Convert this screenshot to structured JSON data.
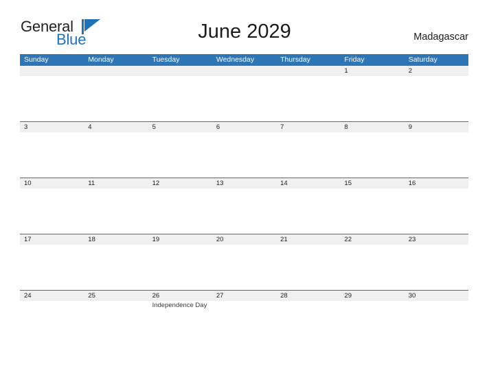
{
  "brand": {
    "name_part1": "General",
    "name_part2": "Blue",
    "mark": "triangle-logo-mark",
    "color_dark": "#231f20",
    "color_blue": "#2072b8"
  },
  "header": {
    "title": "June 2029",
    "country": "Madagascar"
  },
  "calendar": {
    "accent_color": "#2e75b6",
    "band_color": "#f0f0f0",
    "weekdays": [
      "Sunday",
      "Monday",
      "Tuesday",
      "Wednesday",
      "Thursday",
      "Friday",
      "Saturday"
    ],
    "weeks": [
      [
        {
          "date": "",
          "event": ""
        },
        {
          "date": "",
          "event": ""
        },
        {
          "date": "",
          "event": ""
        },
        {
          "date": "",
          "event": ""
        },
        {
          "date": "",
          "event": ""
        },
        {
          "date": "1",
          "event": ""
        },
        {
          "date": "2",
          "event": ""
        }
      ],
      [
        {
          "date": "3",
          "event": ""
        },
        {
          "date": "4",
          "event": ""
        },
        {
          "date": "5",
          "event": ""
        },
        {
          "date": "6",
          "event": ""
        },
        {
          "date": "7",
          "event": ""
        },
        {
          "date": "8",
          "event": ""
        },
        {
          "date": "9",
          "event": ""
        }
      ],
      [
        {
          "date": "10",
          "event": ""
        },
        {
          "date": "11",
          "event": ""
        },
        {
          "date": "12",
          "event": ""
        },
        {
          "date": "13",
          "event": ""
        },
        {
          "date": "14",
          "event": ""
        },
        {
          "date": "15",
          "event": ""
        },
        {
          "date": "16",
          "event": ""
        }
      ],
      [
        {
          "date": "17",
          "event": ""
        },
        {
          "date": "18",
          "event": ""
        },
        {
          "date": "19",
          "event": ""
        },
        {
          "date": "20",
          "event": ""
        },
        {
          "date": "21",
          "event": ""
        },
        {
          "date": "22",
          "event": ""
        },
        {
          "date": "23",
          "event": ""
        }
      ],
      [
        {
          "date": "24",
          "event": ""
        },
        {
          "date": "25",
          "event": ""
        },
        {
          "date": "26",
          "event": "Independence Day"
        },
        {
          "date": "27",
          "event": ""
        },
        {
          "date": "28",
          "event": ""
        },
        {
          "date": "29",
          "event": ""
        },
        {
          "date": "30",
          "event": ""
        }
      ]
    ]
  }
}
